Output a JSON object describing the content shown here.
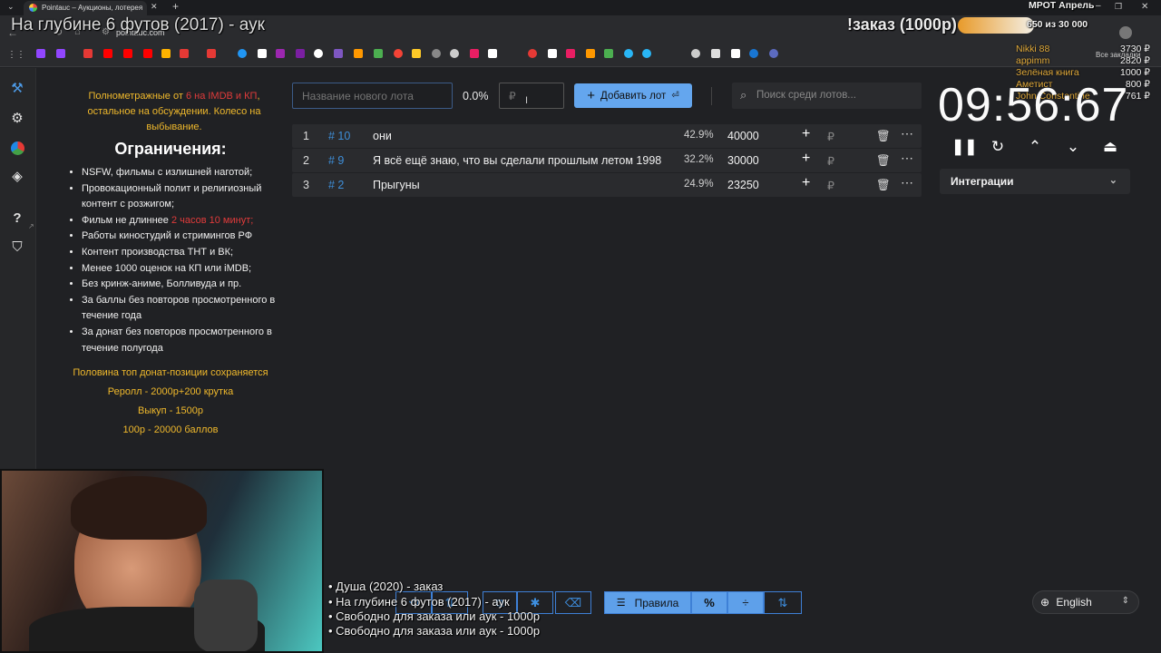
{
  "browser": {
    "tab_title": "Pointauc – Аукционы, лотерея",
    "url": "pointauc.com"
  },
  "overlay_top": {
    "now_playing": "На глубине 6 футов (2017) - аук",
    "order_banner": "!заказ (1000р)",
    "mrot_label": "МРОТ Апрель",
    "mrot_value": "650  из 30 000",
    "other_bookmarks": "Все закладки",
    "donors": [
      {
        "name": "Nikki 88",
        "amount": "3730 ₽"
      },
      {
        "name": "appimm",
        "amount": "2820 ₽"
      },
      {
        "name": "Зелёная книга",
        "amount": "1000 ₽"
      },
      {
        "name": "Аметист",
        "amount": "800 ₽"
      },
      {
        "name": "John Constantine",
        "amount": "761 ₽"
      }
    ]
  },
  "rules": {
    "intro_part1": "Полнометражные от ",
    "intro_red": "6 на IMDB и КП",
    "intro_part2": ", остальное на обсуждении. Колесо на выбывание.",
    "heading": "Ограничения:",
    "items": [
      {
        "text": "NSFW, фильмы с излишней наготой;"
      },
      {
        "text": "Провокационный полит и религиозный контент с розжигом;"
      },
      {
        "text": "Фильм не длиннее ",
        "red": "2 часов 10 минут;"
      },
      {
        "text": "Работы киностудий и стримингов РФ"
      },
      {
        "text": "Контент производства ТНТ и ВК;"
      },
      {
        "text": "Менее 1000 оценок на КП или iMDB;"
      },
      {
        "text": "Без кринж-аниме, Болливуда и пр."
      },
      {
        "text": "За баллы без повторов просмотренного в течение года"
      },
      {
        "text": "За донат без повторов просмотренного в течение полугода"
      }
    ],
    "footer": [
      "Половина топ донат-позиции сохраняется",
      "Реролл - 2000р+200 крутка",
      "Выкуп - 1500р",
      "100р - 20000 баллов"
    ]
  },
  "controls": {
    "new_lot_placeholder": "Название нового лота",
    "percent": "0.0%",
    "amount_placeholder": "₽",
    "add_button": "Добавить лот",
    "search_placeholder": "Поиск среди лотов..."
  },
  "lots": [
    {
      "n": "1",
      "id": "# 10",
      "name": "они",
      "pct": "42.9%",
      "amount": "40000"
    },
    {
      "n": "2",
      "id": "# 9",
      "name": "Я всё ещё знаю, что вы сделали прошлым летом 1998",
      "pct": "32.2%",
      "amount": "30000"
    },
    {
      "n": "3",
      "id": "# 2",
      "name": "Прыгуны",
      "pct": "24.9%",
      "amount": "23250"
    }
  ],
  "timer": {
    "value": "09:56:67"
  },
  "integrations_label": "Интеграции",
  "bottom": {
    "rules_button": "Правила",
    "language": "English"
  },
  "queue": [
    "• Душа (2020) - заказ",
    "• На глубине 6 футов (2017) - аук",
    "• Свободно для заказа или аук - 1000р",
    "• Свободно для заказа или аук - 1000р"
  ]
}
